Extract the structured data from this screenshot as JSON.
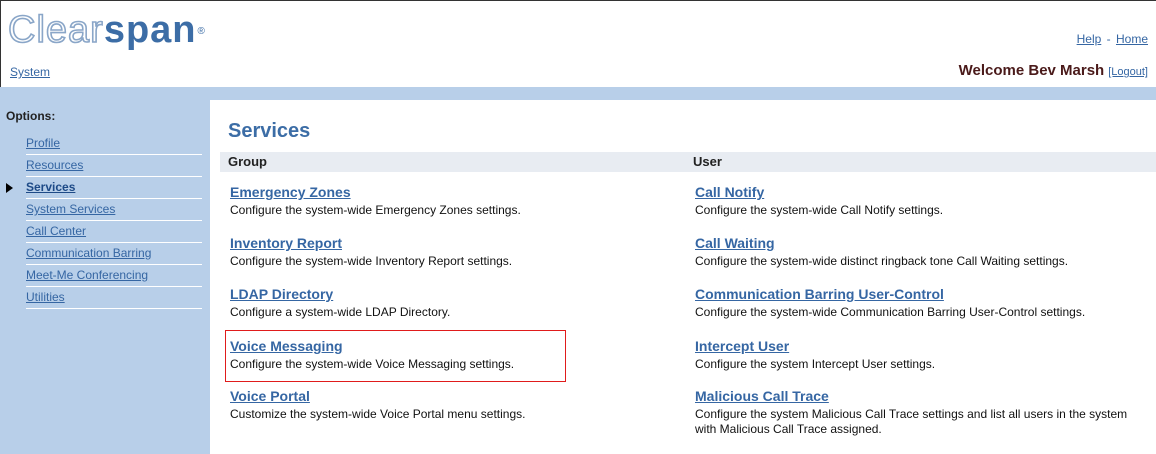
{
  "brand": {
    "logo_part1": "Clear",
    "logo_part2": "span",
    "trademark": "®"
  },
  "header": {
    "help_link": "Help",
    "separator": "-",
    "home_link": "Home",
    "breadcrumb": "System",
    "welcome": "Welcome Bev Marsh",
    "logout": "[Logout]"
  },
  "sidebar": {
    "title": "Options:",
    "items": [
      {
        "label": "Profile"
      },
      {
        "label": "Resources"
      },
      {
        "label": "Services"
      },
      {
        "label": "System Services"
      },
      {
        "label": "Call Center"
      },
      {
        "label": "Communication Barring"
      },
      {
        "label": "Meet-Me Conferencing"
      },
      {
        "label": "Utilities"
      }
    ],
    "active_index": 2
  },
  "main": {
    "title": "Services",
    "group_header": "Group",
    "user_header": "User",
    "group_services": [
      {
        "name": "Emergency Zones",
        "desc": "Configure the system-wide Emergency Zones settings."
      },
      {
        "name": "Inventory Report",
        "desc": "Configure the system-wide Inventory Report settings."
      },
      {
        "name": "LDAP Directory",
        "desc": "Configure a system-wide LDAP Directory."
      },
      {
        "name": "Voice Messaging",
        "desc": "Configure the system-wide Voice Messaging settings."
      },
      {
        "name": "Voice Portal",
        "desc": "Customize the system-wide Voice Portal menu settings."
      }
    ],
    "user_services": [
      {
        "name": "Call Notify",
        "desc": "Configure the system-wide Call Notify settings."
      },
      {
        "name": "Call Waiting",
        "desc": "Configure the system-wide distinct ringback tone Call Waiting settings."
      },
      {
        "name": "Communication Barring User-Control",
        "desc": "Configure the system-wide Communication Barring User-Control settings."
      },
      {
        "name": "Intercept User",
        "desc": "Configure the system Intercept User settings."
      },
      {
        "name": "Malicious Call Trace",
        "desc": "Configure the system Malicious Call Trace settings and list all users in the system with Malicious Call Trace assigned."
      }
    ]
  },
  "colors": {
    "link": "#3566a3",
    "title": "#3c6da6",
    "sidebar_bg": "#b8cfe9",
    "highlight": "#e01b1b"
  }
}
